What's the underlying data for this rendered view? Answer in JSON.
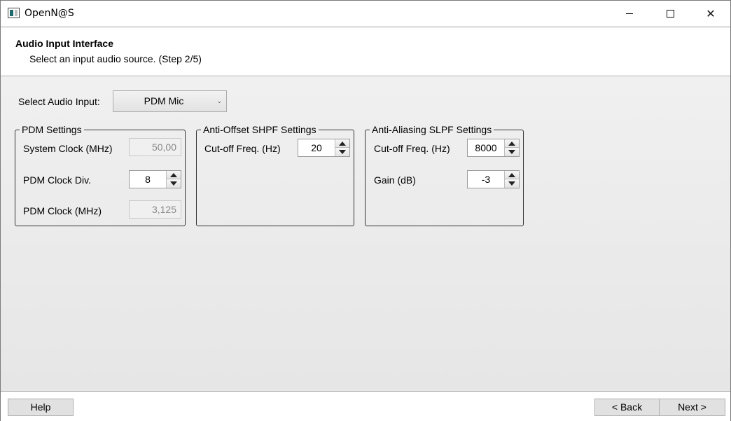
{
  "window": {
    "title": "OpenN@S",
    "icon": "app-icon",
    "controls": [
      "minimize-icon",
      "maximize-icon",
      "close-icon"
    ],
    "close_glyph": "✕"
  },
  "header": {
    "title": "Audio Input Interface",
    "subtitle": "Select an input audio source. (Step 2/5)"
  },
  "audio_input": {
    "label": "Select Audio Input:",
    "selected": "PDM Mic"
  },
  "pdm_settings": {
    "title": "PDM Settings",
    "system_clock_label": "System Clock (MHz)",
    "system_clock_value": "50,00",
    "clock_div_label": "PDM Clock Div.",
    "clock_div_value": "8",
    "pdm_clock_label": "PDM Clock (MHz)",
    "pdm_clock_value": "3,125"
  },
  "shpf_settings": {
    "title": "Anti-Offset SHPF Settings",
    "cutoff_label": "Cut-off Freq. (Hz)",
    "cutoff_value": "20"
  },
  "slpf_settings": {
    "title": "Anti-Aliasing SLPF Settings",
    "cutoff_label": "Cut-off Freq. (Hz)",
    "cutoff_value": "8000",
    "gain_label": "Gain (dB)",
    "gain_value": "-3"
  },
  "footer": {
    "help_label": "Help",
    "back_label": "< Back",
    "next_label": "Next >"
  }
}
